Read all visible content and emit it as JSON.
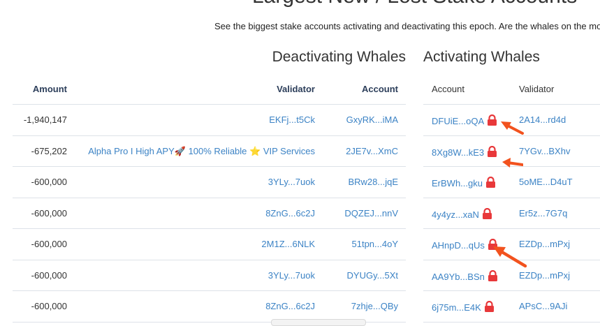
{
  "title": "Largest New / Lost Stake Accounts",
  "subtitle": "See the biggest stake accounts activating and deactivating this epoch. Are the whales on the mo",
  "deactivating": {
    "title": "Deactivating Whales",
    "headers": {
      "amount": "Amount",
      "validator": "Validator",
      "account": "Account"
    },
    "rows": [
      {
        "amount": "-1,940,147",
        "validator": "EKFj...t5Ck",
        "account": "GxyRK...iMA"
      },
      {
        "amount": "-675,202",
        "validator": "Alpha Pro I High APY🚀 100% Reliable ⭐ VIP Services",
        "account": "2JE7v...XmC"
      },
      {
        "amount": "-600,000",
        "validator": "3YLy...7uok",
        "account": "BRw28...jqE"
      },
      {
        "amount": "-600,000",
        "validator": "8ZnG...6c2J",
        "account": "DQZEJ...nnV"
      },
      {
        "amount": "-600,000",
        "validator": "2M1Z...6NLK",
        "account": "51tpn...4oY"
      },
      {
        "amount": "-600,000",
        "validator": "3YLy...7uok",
        "account": "DYUGy...5Xt"
      },
      {
        "amount": "-600,000",
        "validator": "8ZnG...6c2J",
        "account": "7zhje...QBy"
      }
    ]
  },
  "activating": {
    "title": "Activating Whales",
    "headers": {
      "account": "Account",
      "validator": "Validator"
    },
    "rows": [
      {
        "account": "DFUiE...oQA",
        "validator": "2A14...rd4d",
        "locked": true
      },
      {
        "account": "8Xg8W...kE3",
        "validator": "7YGv...BXhv",
        "locked": true
      },
      {
        "account": "ErBWh...gku",
        "validator": "5oME...D4uT",
        "locked": true
      },
      {
        "account": "4y4yz...xaN",
        "validator": "Er5z...7G7q",
        "locked": true
      },
      {
        "account": "AHnpD...qUs",
        "validator": "EZDp...mPxj",
        "locked": true
      },
      {
        "account": "AA9Yb...BSn",
        "validator": "EZDp...mPxj",
        "locked": true
      },
      {
        "account": "6j75m...E4K",
        "validator": "APsC...9AJi",
        "locked": true
      }
    ]
  },
  "colors": {
    "link": "#3c83c5",
    "lock": "#e8383a",
    "arrow": "#f2521e",
    "header": "#2c3e5a"
  },
  "icons": {
    "lock": "lock-icon",
    "annotation": "red-arrow-icon"
  }
}
